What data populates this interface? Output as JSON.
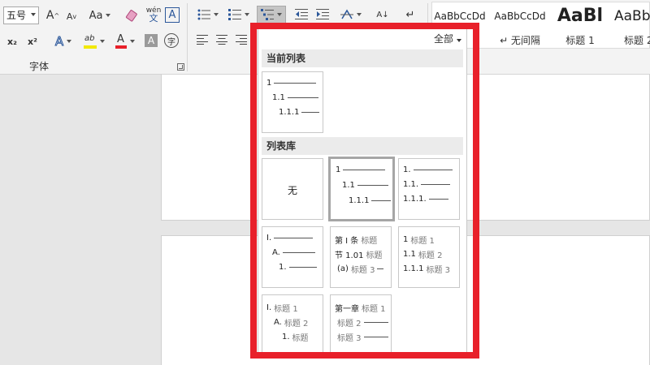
{
  "ribbon": {
    "font_size_value": "五号",
    "grow_font_label": "A",
    "shrink_font_label": "A",
    "change_case_label": "Aa",
    "phonetic_label": "wén",
    "char_border_label": "A",
    "subscript_label": "x₂",
    "superscript_label": "x²",
    "text_effects_label": "A",
    "highlight_label": "ab",
    "font_color_label": "A",
    "char_shading_label": "A",
    "enclose_label": "字",
    "font_group_label": "字体",
    "sort_label": "A↓",
    "colors": {
      "highlight": "#f2e900",
      "font_color": "#e8202a",
      "accent": "#2b579a"
    }
  },
  "styles": [
    {
      "sample": "AaBbCcDd",
      "name": ""
    },
    {
      "sample": "AaBbCcDd",
      "name": "↵ 无间隔"
    },
    {
      "sample": "AaBl",
      "name": "标题 1"
    },
    {
      "sample": "AaBb",
      "name": "标题 2"
    }
  ],
  "panel": {
    "filter_label": "全部",
    "current_section_label": "当前列表",
    "library_section_label": "列表库",
    "current": [
      {
        "lines": [
          {
            "num": "1"
          },
          {
            "num": "1.1"
          },
          {
            "num": "1.1.1"
          }
        ]
      }
    ],
    "library": [
      {
        "none_label": "无"
      },
      {
        "lines": [
          {
            "num": "1"
          },
          {
            "num": "1.1"
          },
          {
            "num": "1.1.1"
          }
        ]
      },
      {
        "lines": [
          {
            "num": "1."
          },
          {
            "num": "1.1."
          },
          {
            "num": "1.1.1."
          }
        ]
      },
      {
        "lines": [
          {
            "num": "I."
          },
          {
            "num": "A."
          },
          {
            "num": "1."
          }
        ]
      },
      {
        "lines": [
          {
            "num": "第 Ⅰ 条",
            "heading": "标题"
          },
          {
            "num": "节 1.01",
            "heading": "标题"
          },
          {
            "num": "(a)",
            "heading": "标题 3"
          }
        ]
      },
      {
        "lines": [
          {
            "num": "1",
            "heading": "标题 1"
          },
          {
            "num": "1.1",
            "heading": "标题 2"
          },
          {
            "num": "1.1.1",
            "heading": "标题 3"
          }
        ]
      },
      {
        "lines": [
          {
            "num": "I.",
            "heading": "标题 1"
          },
          {
            "num": "A.",
            "heading": "标题 2"
          },
          {
            "num": "1.",
            "heading": "标题"
          }
        ]
      },
      {
        "lines": [
          {
            "num": "第一章",
            "heading": "标题 1"
          },
          {
            "num": "",
            "heading": "标题 2"
          },
          {
            "num": "",
            "heading": "标题 3"
          }
        ]
      }
    ],
    "highlight_color": "#e8202a"
  }
}
